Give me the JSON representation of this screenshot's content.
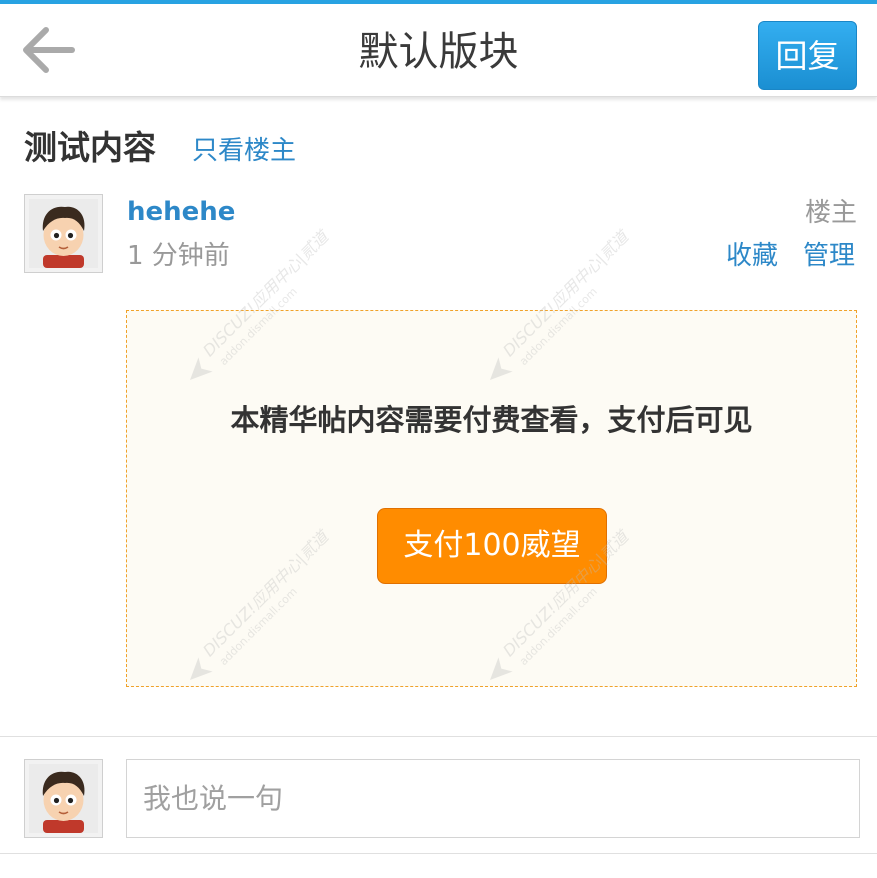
{
  "header": {
    "title": "默认版块",
    "reply_label": "回复",
    "back_icon": "arrow-left-icon",
    "accent_color": "#27a2e2"
  },
  "thread": {
    "title": "测试内容",
    "only_author_label": "只看楼主"
  },
  "post": {
    "username": "hehehe",
    "time": "1 分钟前",
    "author_label": "楼主",
    "favorite_label": "收藏",
    "manage_label": "管理",
    "link_color": "#2d88c8"
  },
  "paywall": {
    "message": "本精华帖内容需要付费查看，支付后可见",
    "button_label": "支付100威望",
    "button_color": "#ff8c00",
    "border_color": "#f0a22a"
  },
  "watermark": {
    "text": "DISCUZ!应用中心|贰道",
    "subtext": "addon.dismall.com"
  },
  "comment": {
    "placeholder": "我也说一句"
  }
}
